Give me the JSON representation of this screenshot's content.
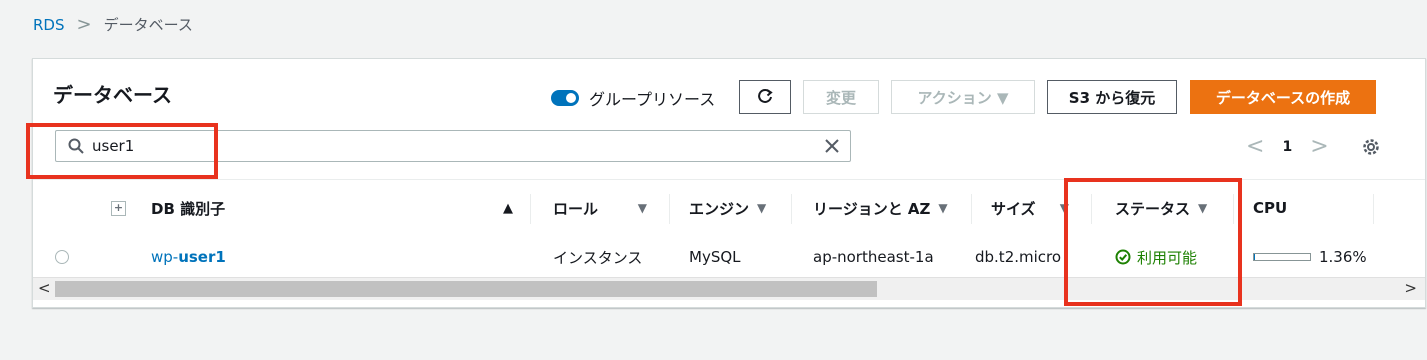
{
  "breadcrumb": {
    "root": "RDS",
    "separator": ">",
    "current": "データベース"
  },
  "panel": {
    "title": "データベース",
    "group_toggle_label": "グループリソース",
    "buttons": {
      "refresh_icon": "refresh-icon",
      "modify": "変更",
      "actions": "アクション ▼",
      "restore_s3": "S3 から復元",
      "create": "データベースの作成"
    },
    "search": {
      "value": "user1",
      "placeholder": ""
    },
    "pagination": {
      "prev": "<",
      "page": "1",
      "next": ">"
    }
  },
  "table": {
    "columns": [
      {
        "label": "DB 識別子",
        "sort": "▲"
      },
      {
        "label": "ロール",
        "sort": "▼"
      },
      {
        "label": "エンジン",
        "sort": "▼"
      },
      {
        "label": "リージョンと AZ",
        "sort": "▼"
      },
      {
        "label": "サイズ",
        "sort": "▼"
      },
      {
        "label": "ステータス",
        "sort": "▼"
      },
      {
        "label": "CPU",
        "sort": ""
      }
    ],
    "rows": [
      {
        "id_prefix": "wp-",
        "id_highlight": "user1",
        "role": "インスタンス",
        "engine": "MySQL",
        "region": "ap-northeast-1a",
        "size": "db.t2.micro",
        "status": "利用可能",
        "cpu": "1.36%",
        "cpu_fraction": 0.0136
      }
    ]
  },
  "colors": {
    "accent": "#0073bb",
    "primary": "#ec7211",
    "success": "#1d8102",
    "highlight": "#e8321e"
  }
}
